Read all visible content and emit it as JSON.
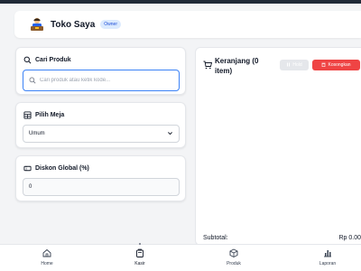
{
  "header": {
    "brand": "Toko Saya",
    "role_badge": "Owner"
  },
  "product_search": {
    "title": "Cari Produk",
    "placeholder": "Cari produk atau ketik kode...",
    "value": ""
  },
  "table_select": {
    "title": "Pilih Meja",
    "selected": "Umum"
  },
  "discount": {
    "title": "Diskon Global (%)",
    "value": "0"
  },
  "cart": {
    "title": "Keranjang (0 item)",
    "hold_label": "Hold",
    "clear_label": "Kosongkan",
    "subtotal_label": "Subtotal:",
    "subtotal_value": "Rp 0.00"
  },
  "nav": {
    "items": [
      {
        "label": "Home",
        "icon": "home-icon"
      },
      {
        "label": "Kasir",
        "icon": "cashier-icon"
      },
      {
        "label": "Produk",
        "icon": "box-icon"
      },
      {
        "label": "Laporan",
        "icon": "chart-icon"
      }
    ],
    "active": "Kasir"
  },
  "colors": {
    "accent": "#3b82f6",
    "danger": "#ef4444",
    "badge_bg": "#dbeafe"
  }
}
